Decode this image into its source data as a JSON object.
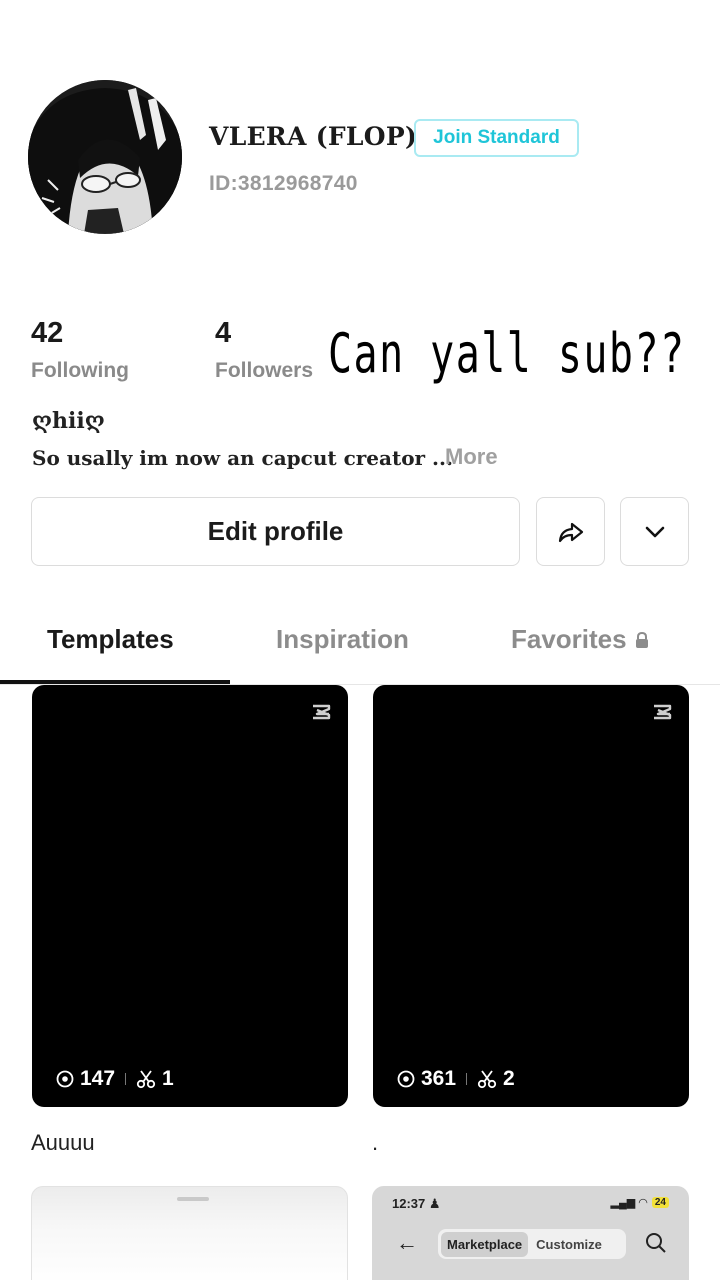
{
  "profile": {
    "username": "VLERA (FLOP)",
    "join_label": "Join Standard",
    "user_id": "ID:3812968740"
  },
  "stats": {
    "following_count": "42",
    "following_label": "Following",
    "followers_count": "4",
    "followers_label": "Followers"
  },
  "overlay_text": "Can yall sub??",
  "bio": {
    "name": "ღhiiღ",
    "text": "So usally im now an capcut creator ...",
    "more_label": "More"
  },
  "actions": {
    "edit_profile_label": "Edit profile",
    "share_icon": "share-icon",
    "dropdown_icon": "chevron-down-icon"
  },
  "tabs": [
    {
      "label": "Templates",
      "active": true
    },
    {
      "label": "Inspiration",
      "active": false
    },
    {
      "label": "Favorites",
      "active": false,
      "icon": "lock-icon"
    }
  ],
  "templates": [
    {
      "views": "147",
      "uses": "1",
      "title": "Auuuu"
    },
    {
      "views": "361",
      "uses": "2",
      "title": "."
    }
  ],
  "preview_card": {
    "time": "12:37",
    "battery": "24",
    "segment_active": "Marketplace",
    "segment_inactive": "Customize"
  },
  "colors": {
    "accent": "#1fc5d8",
    "accent_border": "#a9eaf2",
    "muted_text": "#8a8a8a",
    "card_bg": "#000000"
  }
}
